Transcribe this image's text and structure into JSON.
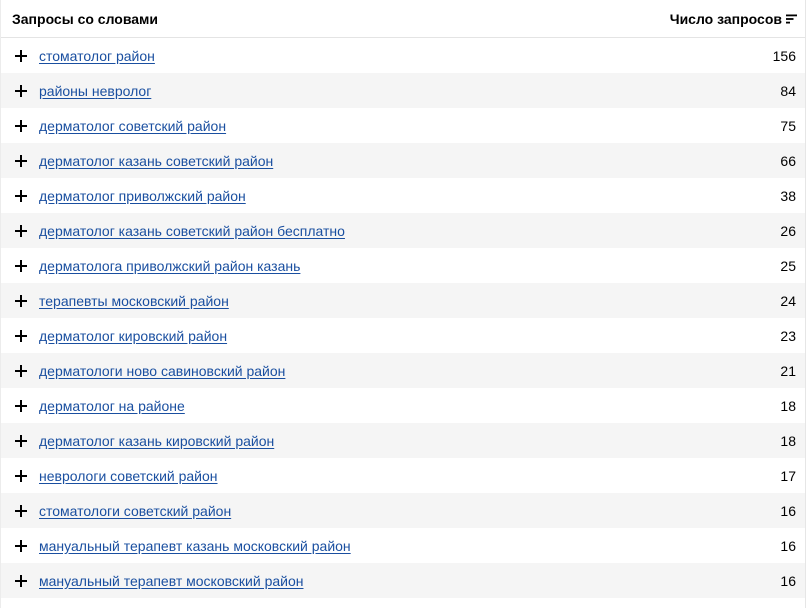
{
  "header": {
    "title": "Запросы со словами",
    "count_label": "Число запросов",
    "sort_icon": "sort-descending-icon"
  },
  "rows": [
    {
      "query": "стоматолог район",
      "count": "156"
    },
    {
      "query": "районы невролог",
      "count": "84"
    },
    {
      "query": "дерматолог советский район",
      "count": "75"
    },
    {
      "query": "дерматолог казань советский район",
      "count": "66"
    },
    {
      "query": "дерматолог приволжский район",
      "count": "38"
    },
    {
      "query": "дерматолог казань советский район бесплатно",
      "count": "26"
    },
    {
      "query": "дерматолога приволжский район казань",
      "count": "25"
    },
    {
      "query": "терапевты московский район",
      "count": "24"
    },
    {
      "query": "дерматолог кировский район",
      "count": "23"
    },
    {
      "query": "дерматологи ново савиновский район",
      "count": "21"
    },
    {
      "query": "дерматолог на районе",
      "count": "18"
    },
    {
      "query": "дерматолог казань кировский район",
      "count": "18"
    },
    {
      "query": "неврологи советский район",
      "count": "17"
    },
    {
      "query": "стоматологи советский район",
      "count": "16"
    },
    {
      "query": "мануальный терапевт казань московский район",
      "count": "16"
    },
    {
      "query": "мануальный терапевт московский район",
      "count": "16"
    }
  ],
  "colors": {
    "link": "#1a4fa0",
    "alt_row": "#f5f5f5"
  }
}
